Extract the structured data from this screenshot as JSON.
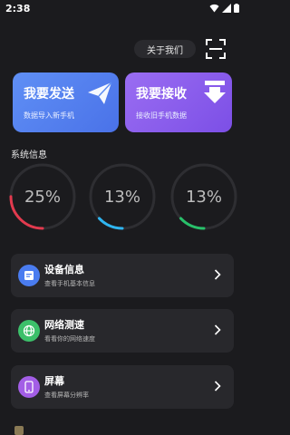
{
  "status_bar": {
    "time": "2:38"
  },
  "header": {
    "about_label": "关于我们"
  },
  "cards": {
    "send": {
      "title": "我要发送",
      "subtitle": "数据导入新手机"
    },
    "receive": {
      "title": "我要接收",
      "subtitle": "接收旧手机数据"
    }
  },
  "system_info": {
    "title": "系统信息",
    "gauges": [
      {
        "label": "25%",
        "value": 0.25,
        "color": "#e23a4e"
      },
      {
        "label": "13%",
        "value": 0.13,
        "color": "#2fb5f0"
      },
      {
        "label": "13%",
        "value": 0.13,
        "color": "#28c06a"
      }
    ]
  },
  "rows": [
    {
      "title": "设备信息",
      "subtitle": "查看手机基本信息",
      "icon": "document-icon",
      "color": "#4a7cf0"
    },
    {
      "title": "网络测速",
      "subtitle": "看看你的网络速度",
      "icon": "globe-icon",
      "color": "#3cc06a"
    },
    {
      "title": "屏幕",
      "subtitle": "查看屏幕分辨率",
      "icon": "phone-icon",
      "color": "#a35ee6"
    }
  ]
}
